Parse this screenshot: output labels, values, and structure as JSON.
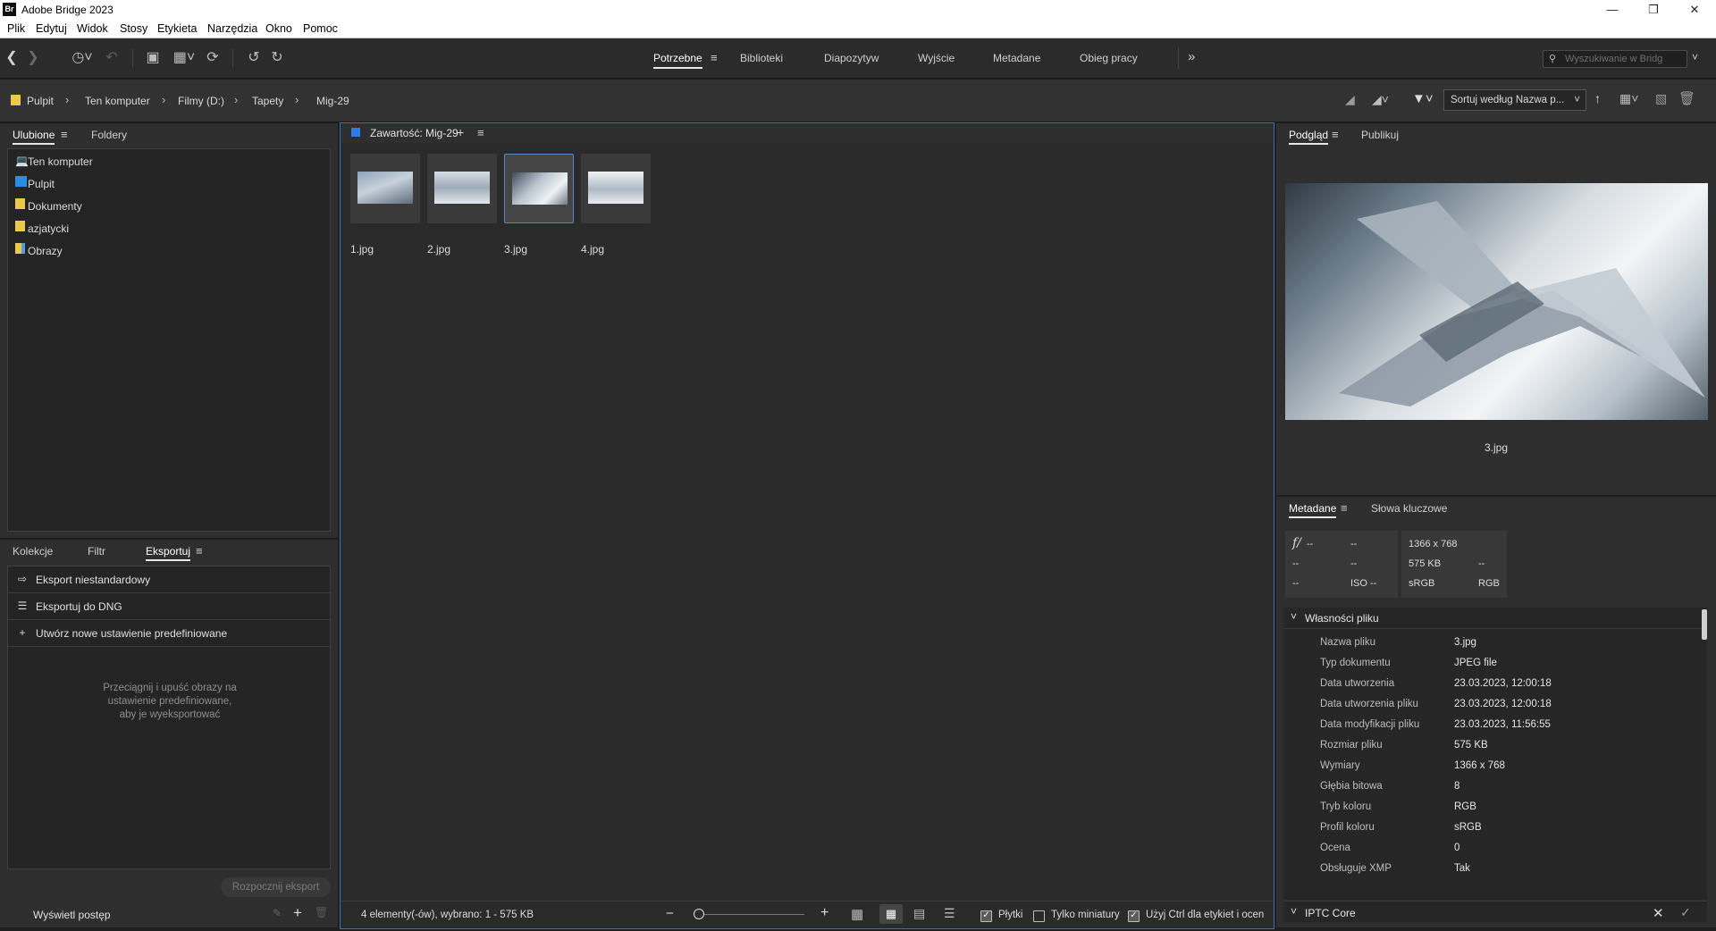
{
  "window": {
    "app_icon": "Br",
    "title": "Adobe Bridge 2023",
    "controls": [
      "minimize",
      "restore",
      "close"
    ]
  },
  "menu": [
    "Plik",
    "Edytuj",
    "Widok",
    "Stosy",
    "Etykieta",
    "Narzędzia",
    "Okno",
    "Pomoc"
  ],
  "workspaces": {
    "tabs": [
      "Potrzebne",
      "Biblioteki",
      "Diapozytyw",
      "Wyjście",
      "Metadane",
      "Obieg pracy"
    ],
    "active": "Potrzebne",
    "more": "»",
    "search_placeholder": "Wyszukiwanie w Bridg"
  },
  "breadcrumb": [
    "Pulpit",
    "Ten komputer",
    "Filmy (D:)",
    "Tapety",
    "Mig-29"
  ],
  "sort_label": "Sortuj według Nazwa p...",
  "favorites": {
    "tabs": [
      "Ulubione",
      "Foldery"
    ],
    "items": [
      {
        "label": "Ten komputer",
        "icon": "computer-icon"
      },
      {
        "label": "Pulpit",
        "icon": "desktop-folder-icon"
      },
      {
        "label": "Dokumenty",
        "icon": "folder-icon"
      },
      {
        "label": "azjatycki",
        "icon": "folder-icon"
      },
      {
        "label": "Obrazy",
        "icon": "pictures-folder-icon"
      }
    ]
  },
  "export_panel": {
    "tabs": [
      "Kolekcje",
      "Filtr",
      "Eksportuj"
    ],
    "items": [
      "Eksport niestandardowy",
      "Eksportuj do DNG",
      "Utwórz nowe ustawienie predefiniowane"
    ],
    "drop_hint": [
      "Przeciągnij i upuść obrazy na",
      "ustawienie predefiniowane,",
      "aby je wyeksportować"
    ],
    "start_button": "Rozpocznij eksport",
    "progress_label": "Wyświetl postęp"
  },
  "content": {
    "title": "Zawartość: Mig-29",
    "files": [
      "1.jpg",
      "2.jpg",
      "3.jpg",
      "4.jpg"
    ],
    "selected": "3.jpg",
    "status": "4 elementy(-ów), wybrano: 1 - 575 KB",
    "options": {
      "tiles": "Płytki",
      "thumbs_only": "Tylko miniatury",
      "ctrl_labels": "Użyj Ctrl dla etykiet i ocen"
    }
  },
  "preview": {
    "tabs": [
      "Podgląd",
      "Publikuj"
    ],
    "filename": "3.jpg"
  },
  "metadata": {
    "tabs": [
      "Metadane",
      "Słowa kluczowe"
    ],
    "camera": {
      "aperture_icon": "f/",
      "cells": [
        "--",
        "--",
        "--",
        "--",
        "--",
        "ISO --"
      ],
      "file_cells": [
        "1366 x 768",
        "575 KB",
        "--",
        "sRGB",
        "RGB"
      ]
    },
    "section_file": "Własności pliku",
    "rows": [
      {
        "label": "Nazwa pliku",
        "value": "3.jpg"
      },
      {
        "label": "Typ dokumentu",
        "value": "JPEG file"
      },
      {
        "label": "Data utworzenia",
        "value": "23.03.2023, 12:00:18"
      },
      {
        "label": "Data utworzenia pliku",
        "value": "23.03.2023, 12:00:18"
      },
      {
        "label": "Data modyfikacji pliku",
        "value": "23.03.2023, 11:56:55"
      },
      {
        "label": "Rozmiar pliku",
        "value": "575 KB"
      },
      {
        "label": "Wymiary",
        "value": "1366 x 768"
      },
      {
        "label": "Głębia bitowa",
        "value": "8"
      },
      {
        "label": "Tryb koloru",
        "value": "RGB"
      },
      {
        "label": "Profil koloru",
        "value": "sRGB"
      },
      {
        "label": "Ocena",
        "value": "0"
      },
      {
        "label": "Obsługuje XMP",
        "value": "Tak"
      }
    ],
    "section_iptc": "IPTC Core"
  },
  "colors": {
    "accent": "#2d7be5",
    "selection": "#5a86c5",
    "panel": "#2e2e2e",
    "background": "#1e1e1e"
  }
}
